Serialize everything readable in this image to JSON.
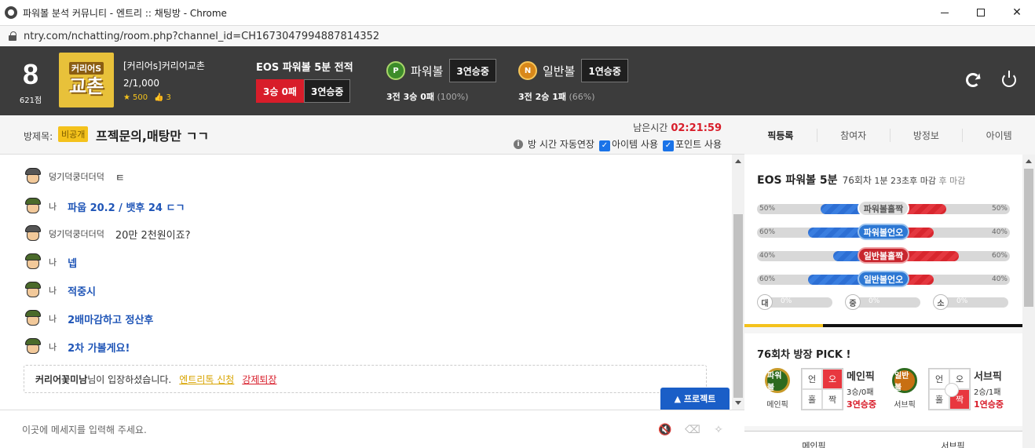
{
  "window": {
    "title": "파워볼 분석 커뮤니티 - 엔트리 :: 채팅방 - Chrome",
    "url": "ntry.com/nchatting/room.php?channel_id=CH1673047994887814352"
  },
  "header": {
    "level": "8",
    "points": "621점",
    "avatar_line1": "커리어S",
    "avatar_line2": "교촌",
    "room_owner": "[커리어s]커리어교촌",
    "member_count": "2/1,000",
    "stars": "500",
    "likes": "3",
    "eos_label": "EOS 파워볼 5분 전적",
    "eos_record": "3승 0패",
    "eos_streak": "3연승중",
    "powerball": {
      "coin": "P",
      "label": "파워볼",
      "streak": "3연승중",
      "record": "3전 3승 0패",
      "pct": "(100%)"
    },
    "normalball": {
      "coin": "N",
      "label": "일반볼",
      "streak": "1연승중",
      "record": "3전 2승 1패",
      "pct": "(66%)"
    }
  },
  "roombar": {
    "label": "방제목:",
    "public_badge": "비공개",
    "title": "프젝문의,매탕만 ㄱㄱ",
    "timer_label": "남은시간",
    "timer_value": "02:21:59",
    "auto_extend": "방 시간 자동연장",
    "item_use": "아이템 사용",
    "point_use": "포인트 사용"
  },
  "tabs": [
    "픽등록",
    "참여자",
    "방정보",
    "아이템"
  ],
  "chat": {
    "messages": [
      {
        "nick": "덩기덕쿵더더덕",
        "text": "ㅌ",
        "me": false
      },
      {
        "nick": "나",
        "text": "파웁 20.2 / 뱃후 24 ㄷㄱ",
        "me": true
      },
      {
        "nick": "덩기덕쿵더더덕",
        "text": "20만 2천원이죠?",
        "me": false
      },
      {
        "nick": "나",
        "text": "넵",
        "me": true
      },
      {
        "nick": "나",
        "text": "적중시",
        "me": true
      },
      {
        "nick": "나",
        "text": "2배마감하고 정산후",
        "me": true
      },
      {
        "nick": "나",
        "text": "2차 가볼게요!",
        "me": true
      }
    ],
    "system": {
      "user": "커리어꽃미남",
      "suffix": "님이 입장하셨습니다.",
      "link1": "엔트리톡 신청",
      "link2": "강제퇴장"
    },
    "project_button": "▲ 프로젝트"
  },
  "input": {
    "placeholder": "이곳에 메세지를 입력해 주세요."
  },
  "game": {
    "title": "EOS 파워볼 5분",
    "round": "76회차",
    "remaining": "1분 23초후 마감",
    "note": "후 마감",
    "bars": [
      {
        "label": "파워볼홀짝",
        "left": "50%",
        "right": "50%",
        "style": "gray",
        "blue": 50,
        "red": 50
      },
      {
        "label": "파워볼언오",
        "left": "60%",
        "right": "40%",
        "style": "blue",
        "blue": 60,
        "red": 40
      },
      {
        "label": "일반볼홀짝",
        "left": "40%",
        "right": "60%",
        "style": "red",
        "blue": 40,
        "red": 60
      },
      {
        "label": "일반볼언오",
        "left": "60%",
        "right": "40%",
        "style": "blue",
        "blue": 60,
        "red": 40
      }
    ],
    "sizes": [
      {
        "label": "대",
        "pct": "0%"
      },
      {
        "label": "중",
        "pct": "0%"
      },
      {
        "label": "소",
        "pct": "0%"
      }
    ]
  },
  "pick": {
    "title": "76회차 방장 PICK !",
    "main": {
      "coin": "파워볼",
      "sub": "메인픽",
      "cells": [
        "언",
        "오",
        "홀",
        "짝"
      ],
      "name": "메인픽",
      "record": "3승/0패",
      "streak": "3연승중"
    },
    "subpick": {
      "coin": "일반볼",
      "sub": "서브픽",
      "cells": [
        "언",
        "오",
        "홀",
        "짝"
      ],
      "name": "서브픽",
      "record": "2승/1패",
      "streak": "1연승중"
    }
  },
  "bottom_tabs": [
    "메인픽",
    "서브픽"
  ]
}
